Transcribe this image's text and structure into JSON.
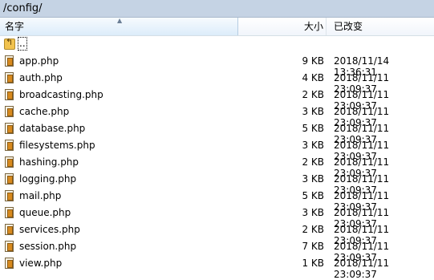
{
  "path": "/config/",
  "columns": {
    "name": "名字",
    "size": "大小",
    "modified": "已改变"
  },
  "sort_indicator": "▲",
  "parent_dir": {
    "label": "..",
    "icon": "up-folder-icon"
  },
  "files": [
    {
      "name": "app.php",
      "size": "9 KB",
      "modified": "2018/11/14 13:36:31"
    },
    {
      "name": "auth.php",
      "size": "4 KB",
      "modified": "2018/11/11 23:09:37"
    },
    {
      "name": "broadcasting.php",
      "size": "2 KB",
      "modified": "2018/11/11 23:09:37"
    },
    {
      "name": "cache.php",
      "size": "3 KB",
      "modified": "2018/11/11 23:09:37"
    },
    {
      "name": "database.php",
      "size": "5 KB",
      "modified": "2018/11/11 23:09:37"
    },
    {
      "name": "filesystems.php",
      "size": "3 KB",
      "modified": "2018/11/11 23:09:37"
    },
    {
      "name": "hashing.php",
      "size": "2 KB",
      "modified": "2018/11/11 23:09:37"
    },
    {
      "name": "logging.php",
      "size": "3 KB",
      "modified": "2018/11/11 23:09:37"
    },
    {
      "name": "mail.php",
      "size": "5 KB",
      "modified": "2018/11/11 23:09:37"
    },
    {
      "name": "queue.php",
      "size": "3 KB",
      "modified": "2018/11/11 23:09:37"
    },
    {
      "name": "services.php",
      "size": "2 KB",
      "modified": "2018/11/11 23:09:37"
    },
    {
      "name": "session.php",
      "size": "7 KB",
      "modified": "2018/11/11 23:09:37"
    },
    {
      "name": "view.php",
      "size": "1 KB",
      "modified": "2018/11/11 23:09:37"
    }
  ],
  "colors": {
    "path_bar": "#c5d3e4",
    "sorted_header": "#dcecfa",
    "file_icon": "#d88a1e"
  }
}
